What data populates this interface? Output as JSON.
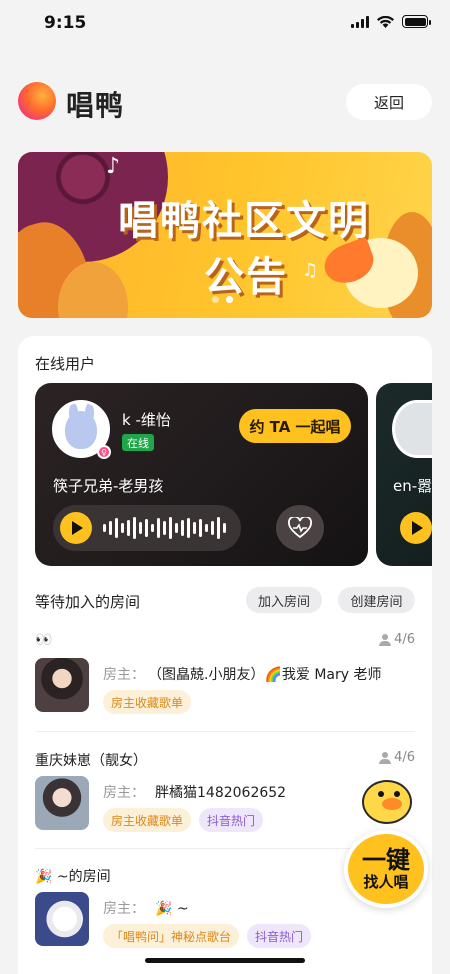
{
  "status_bar": {
    "time": "9:15"
  },
  "header": {
    "app_name": "唱鸭",
    "back_label": "返回"
  },
  "banner": {
    "title_line1": "唱鸭社区文明",
    "title_line2": "公告",
    "pages": 2,
    "active_page": 1
  },
  "online_users": {
    "section_title": "在线用户",
    "cards": [
      {
        "name": "k -维怡",
        "status": "在线",
        "song": "筷子兄弟-老男孩",
        "invite_label": "约 TA 一起唱",
        "gender": "female"
      },
      {
        "name": "en-嚣"
      }
    ]
  },
  "rooms": {
    "section_title": "等待加入的房间",
    "join_label": "加入房间",
    "create_label": "创建房间",
    "owner_label": "房主：",
    "items": [
      {
        "name": "👀",
        "count": "4/6",
        "owner": "（图皛兢.小朋友）🌈我爱 Mary 老师",
        "tags": [
          "房主收藏歌单"
        ]
      },
      {
        "name": "重庆妹崽（靓女）",
        "count": "4/6",
        "owner": "胖橘猫1482062652",
        "tags": [
          "房主收藏歌单",
          "抖音热门"
        ]
      },
      {
        "name": "🎉 ~的房间",
        "count": "",
        "owner": "🎉 ~",
        "tags": [
          "「唱鸭问」神秘点歌台",
          "抖音热门"
        ]
      }
    ]
  },
  "fab": {
    "line1": "一键",
    "line2": "找人唱"
  },
  "colors": {
    "accent": "#ffc11e",
    "online": "#1fa64a",
    "tag_orange": "#d9881c",
    "tag_purple": "#8a5cd1"
  }
}
